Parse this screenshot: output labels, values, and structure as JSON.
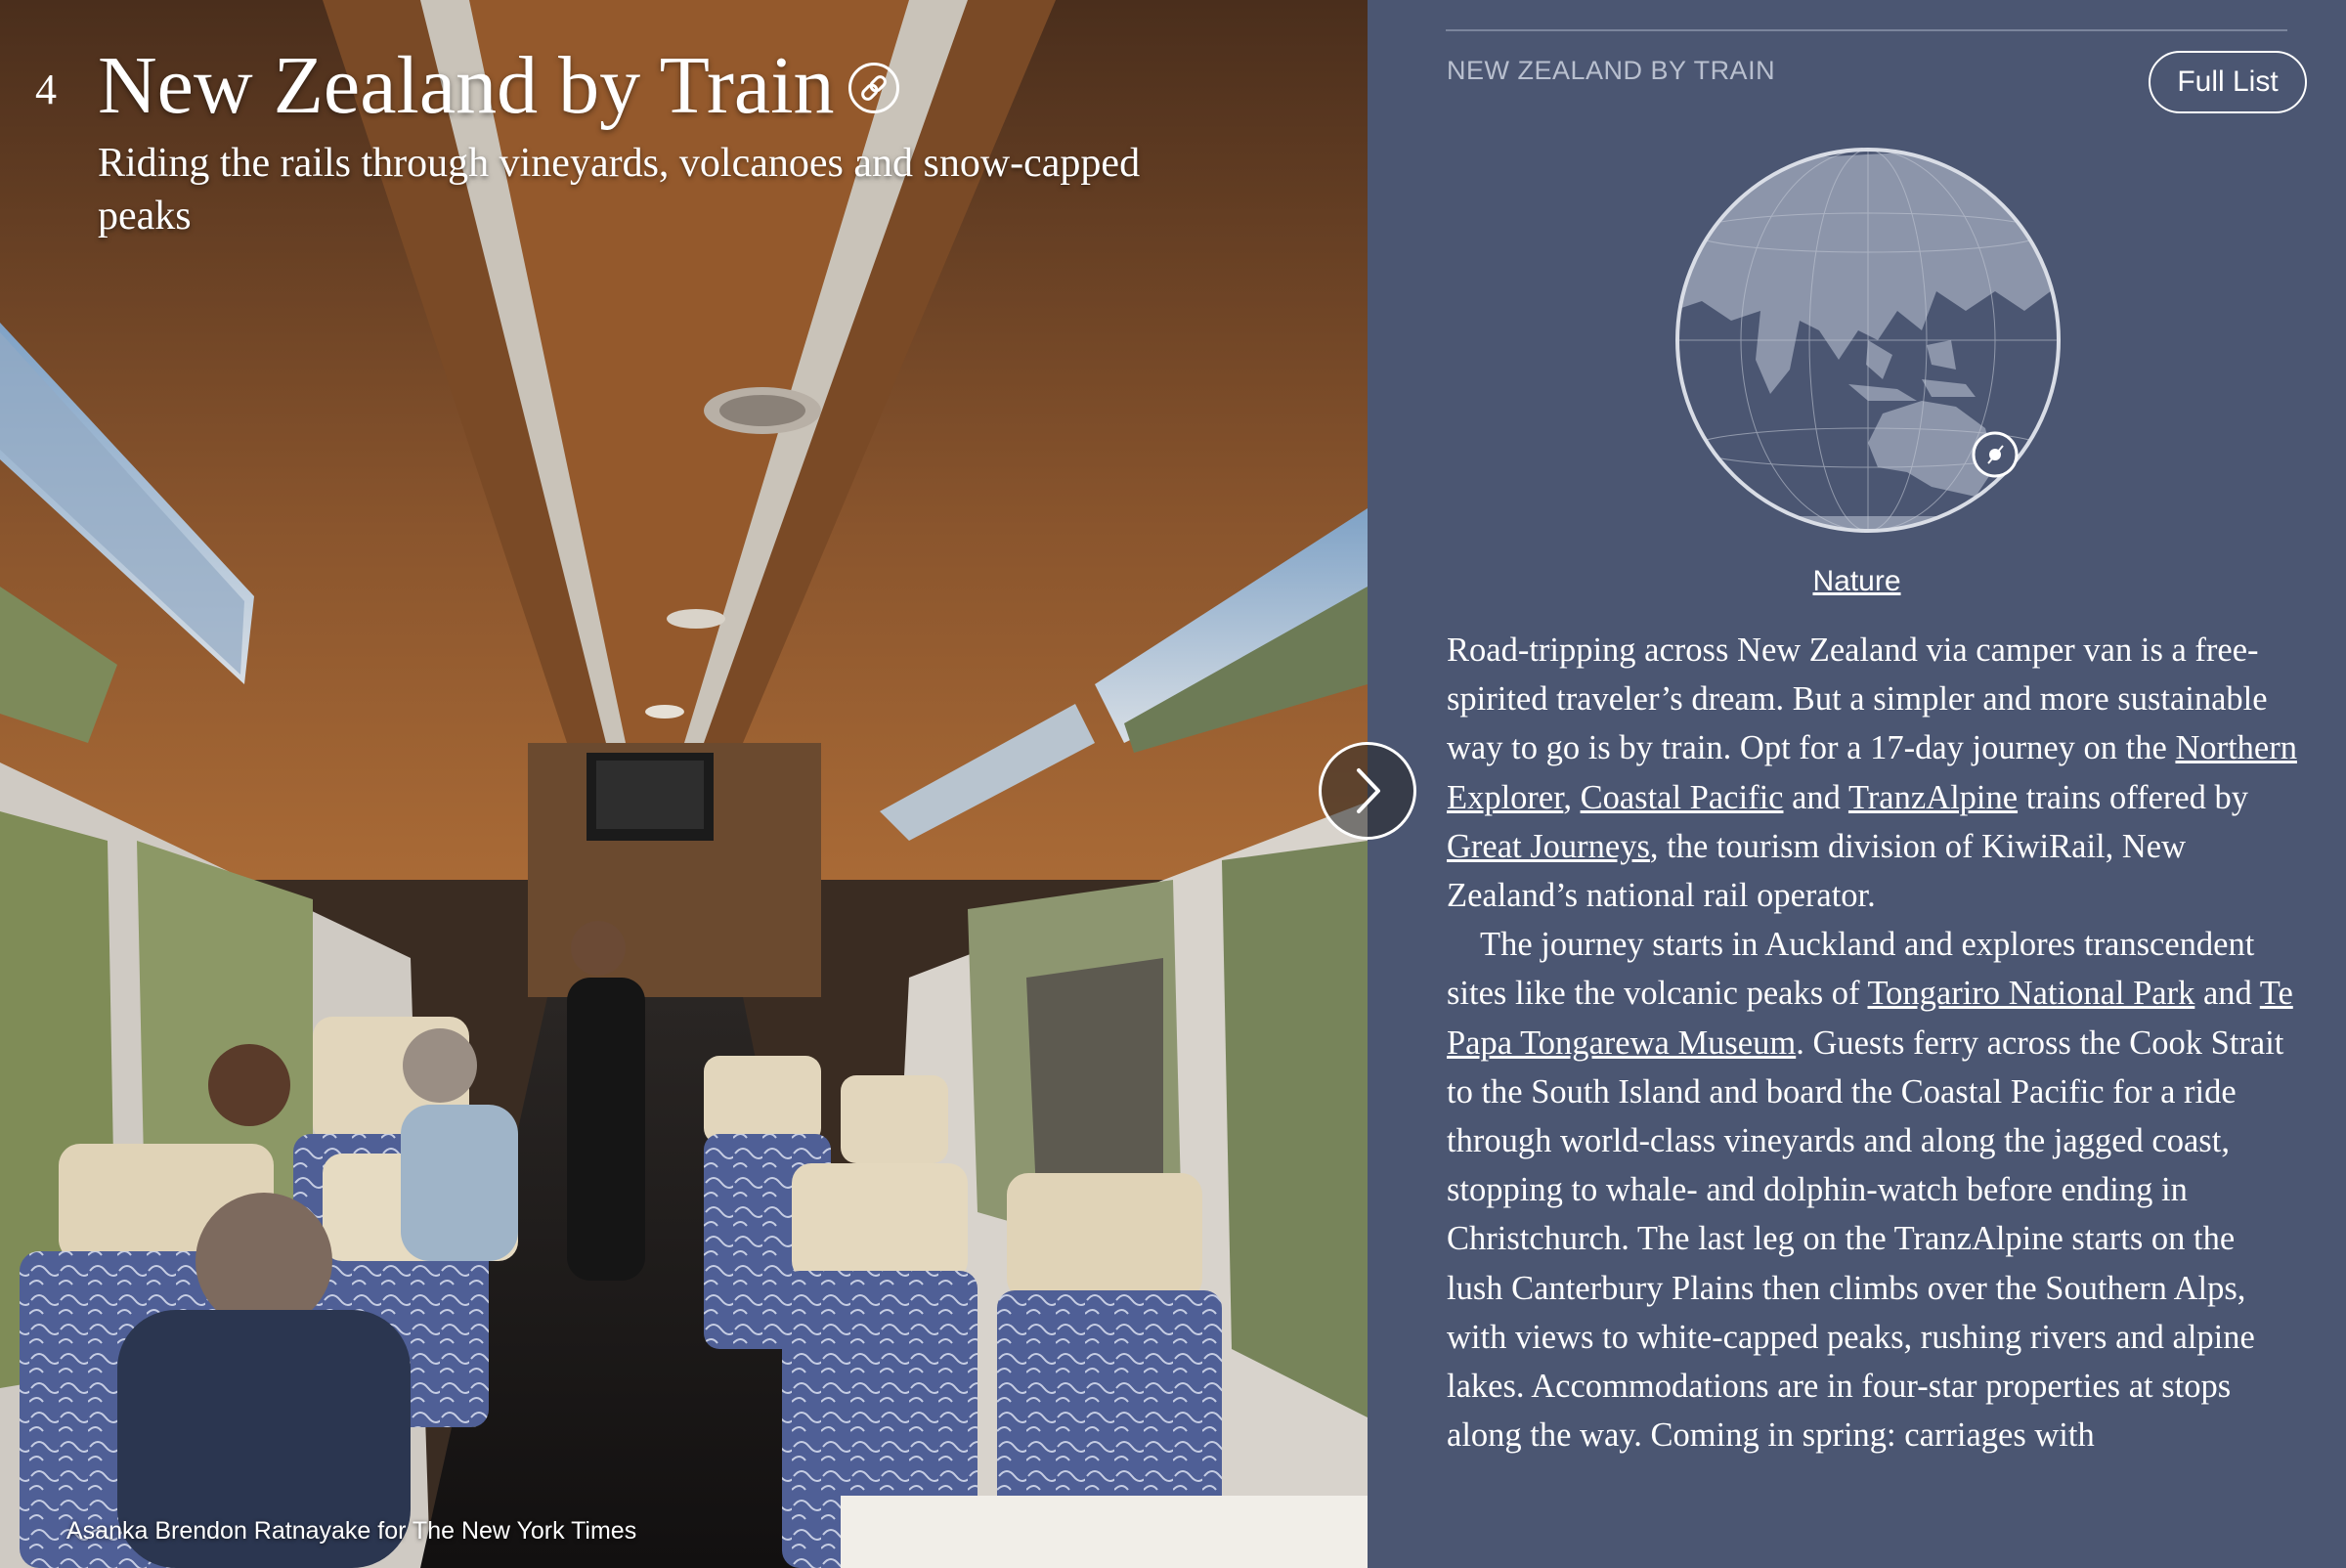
{
  "item": {
    "number": "4",
    "title": "New Zealand by Train",
    "subtitle": "Riding the rails through vineyards, volcanoes and snow-capped peaks",
    "photo_credit": "Asanka Brendon Ratnayake for The New York Times",
    "link_icon": "link-icon"
  },
  "nav": {
    "next_icon": "chevron-right-icon"
  },
  "sidebar": {
    "section_label": "NEW ZEALAND BY TRAIN",
    "full_list_label": "Full List",
    "category": "Nature"
  },
  "article": {
    "p1": {
      "t1": "Road-tripping across New Zealand via camper van is a free-spirited traveler’s dream. But a simpler and more sustainable way to go is by train. Opt for a 17-day journey on the ",
      "link1": "Northern Explorer",
      "t2": ", ",
      "link2": "Coastal Pacific",
      "t3": " and ",
      "link3": "TranzAlpine",
      "t4": " trains offered by ",
      "link4": "Great Journeys",
      "t5": ", the tourism division of KiwiRail, New Zealand’s national rail operator."
    },
    "p2": {
      "t1": "The journey starts in Auckland and explores transcendent sites like the volcanic peaks of ",
      "link1": "Tongariro National Park",
      "t2": " and ",
      "link2": "Te Papa Tongarewa Museum",
      "t3": ". Guests ferry across the Cook Strait to the South Island and board the Coastal Pacific for a ride through world-class vineyards and along the jagged coast, stopping to whale- and dolphin-watch before ending in Christchurch. The last leg on the TranzAlpine starts on the lush Canterbury Plains then climbs over the Southern Alps, with views to white-capped peaks, rushing rivers and alpine lakes. Accommodations are in four-star properties at stops along the way. Coming in spring: carriages with"
    }
  },
  "colors": {
    "panel_bg": "#4b5672",
    "globe_water": "#4b5672",
    "globe_land": "#8c95aa"
  }
}
